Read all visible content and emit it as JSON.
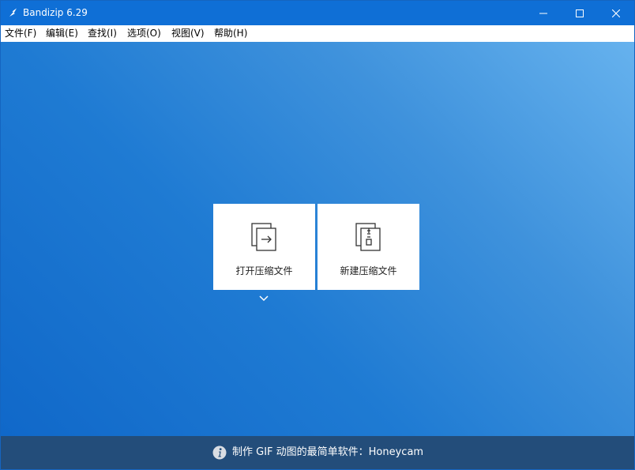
{
  "window": {
    "title": "Bandizip 6.29",
    "controls": [
      "minimize",
      "maximize",
      "close"
    ]
  },
  "menu": {
    "items": [
      {
        "label": "文件(F)"
      },
      {
        "label": "编辑(E)"
      },
      {
        "label": "查找(I)"
      },
      {
        "label": "选项(O)"
      },
      {
        "label": "视图(V)"
      },
      {
        "label": "帮助(H)"
      }
    ]
  },
  "main": {
    "tiles": [
      {
        "label": "打开压缩文件",
        "icon": "open-archive-icon"
      },
      {
        "label": "新建压缩文件",
        "icon": "new-archive-icon"
      }
    ]
  },
  "status": {
    "icon": "info-icon",
    "text": "制作 GIF 动图的最简单软件：Honeycam"
  },
  "colors": {
    "titlebar": "#0f6fd6",
    "statusbar": "#234d7a",
    "background_light": "#66b2ee",
    "background_dark": "#1068c9"
  }
}
